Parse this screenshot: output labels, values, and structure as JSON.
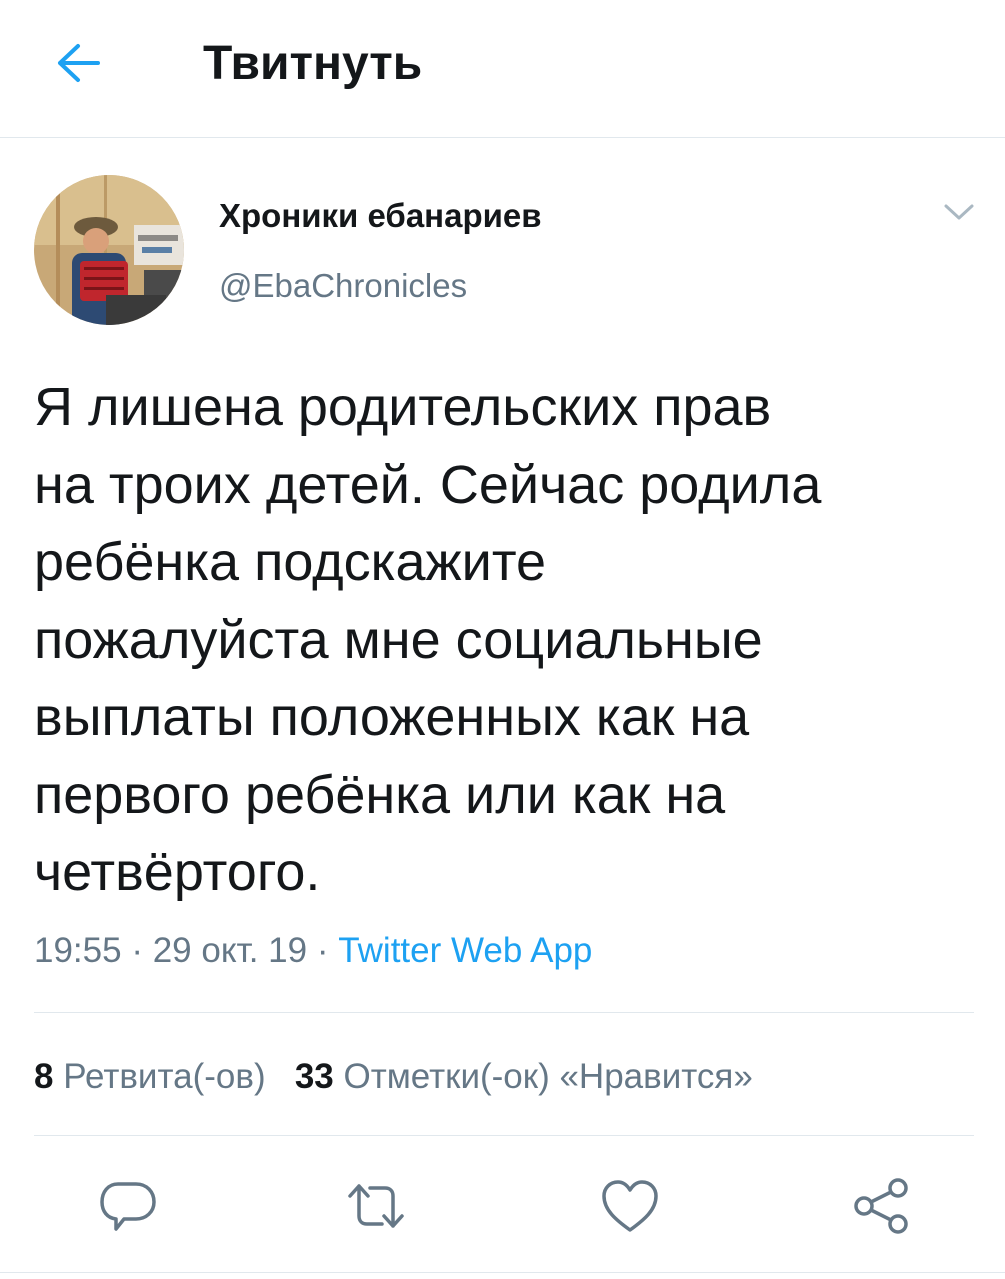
{
  "header": {
    "title": "Твитнуть",
    "back_icon": "arrow-left-icon"
  },
  "colors": {
    "accent": "#1da1f2",
    "text_primary": "#14171a",
    "text_secondary": "#657786",
    "divider": "#e1e8ed"
  },
  "tweet": {
    "author": {
      "display_name": "Хроники ебанариев",
      "handle": "@EbaChronicles",
      "avatar_icon": "avatar-photo"
    },
    "menu_icon": "chevron-down-icon",
    "text": "Я лишена родительских прав\nна троих детей. Сейчас родила\nребёнка подскажите\nпожалуйста мне социальные\nвыплаты положенных как на\nпервого ребёнка или как на\nчетвёртого.",
    "time": "19:55",
    "date": "29 окт. 19",
    "source": "Twitter Web App",
    "separator": "·"
  },
  "stats": {
    "retweets_count": "8",
    "retweets_label": "Ретвита(-ов)",
    "likes_count": "33",
    "likes_label": "Отметки(-ок) «Нравится»"
  },
  "actions": [
    {
      "name": "reply",
      "icon": "reply-icon"
    },
    {
      "name": "retweet",
      "icon": "retweet-icon"
    },
    {
      "name": "like",
      "icon": "heart-icon"
    },
    {
      "name": "share",
      "icon": "share-icon"
    }
  ]
}
